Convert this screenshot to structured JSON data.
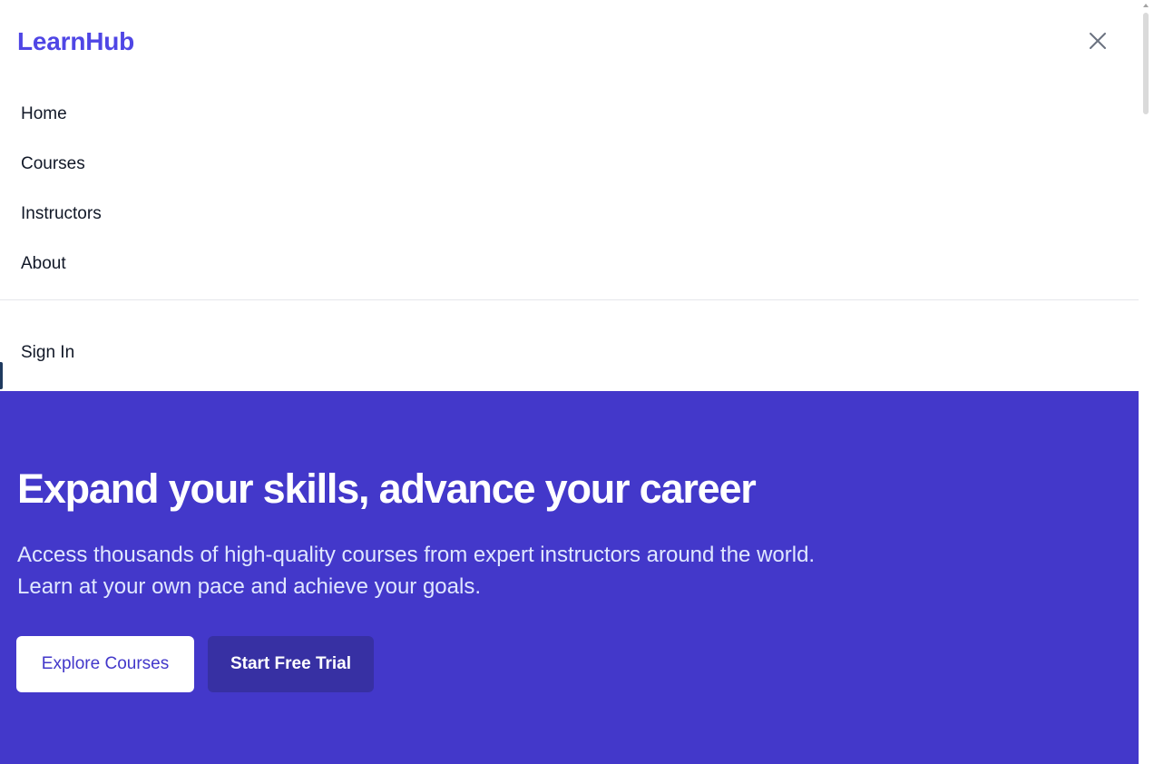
{
  "header": {
    "brand": "LearnHub",
    "close_icon": "close-icon"
  },
  "nav": {
    "items": [
      {
        "label": "Home"
      },
      {
        "label": "Courses"
      },
      {
        "label": "Instructors"
      },
      {
        "label": "About"
      }
    ],
    "sign_in": "Sign In"
  },
  "hero": {
    "title": "Expand your skills, advance your career",
    "subtitle_line1": "Access thousands of high-quality courses from expert instructors around the world.",
    "subtitle_line2": "Learn at your own pace and achieve your goals.",
    "primary_button": "Explore Courses",
    "secondary_button": "Start Free Trial"
  },
  "colors": {
    "brand": "#4f46e5",
    "hero_background": "#4338ca",
    "secondary_button": "#3730a3",
    "text": "#111827"
  }
}
